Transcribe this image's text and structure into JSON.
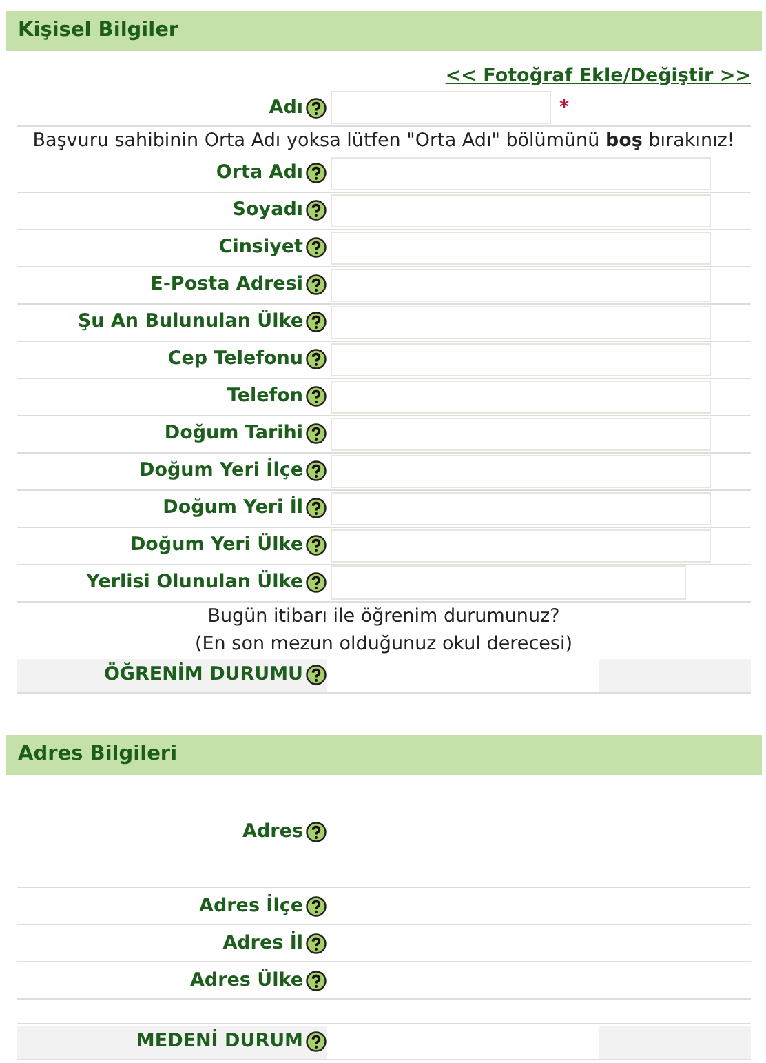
{
  "sections": [
    {
      "title": "Kişisel Bilgiler",
      "rows": [
        {
          "kind": "link",
          "text": "<< Fotoğraf Ekle/Değiştir >>"
        },
        {
          "kind": "short_field",
          "label": "Adı",
          "required_mark": "*"
        },
        {
          "kind": "note",
          "text": "Başvuru sahibinin Orta Adı yoksa lütfen \"Orta Adı\" bölümünü **boş** bırakınız!"
        },
        {
          "kind": "field",
          "label": "Orta Adı"
        },
        {
          "kind": "field",
          "label": "Soyadı"
        },
        {
          "kind": "field",
          "label": "Cinsiyet"
        },
        {
          "kind": "field",
          "label": "E-Posta Adresi"
        },
        {
          "kind": "field",
          "label": "Şu An Bulunulan Ülke"
        },
        {
          "kind": "field",
          "label": "Cep Telefonu"
        },
        {
          "kind": "field",
          "label": "Telefon"
        },
        {
          "kind": "field",
          "label": "Doğum Tarihi"
        },
        {
          "kind": "field",
          "label": "Doğum Yeri İlçe"
        },
        {
          "kind": "field",
          "label": "Doğum Yeri İl"
        },
        {
          "kind": "field",
          "label": "Doğum Yeri Ülke"
        },
        {
          "kind": "box_field",
          "label": "Yerlisi Olunulan Ülke"
        },
        {
          "kind": "note",
          "text": "Bugün itibarı ile öğrenim durumunuz?"
        },
        {
          "kind": "note",
          "text": "(En son mezun olduğunuz okul derecesi)"
        },
        {
          "kind": "gray",
          "label": "ÖĞRENİM DURUMU"
        }
      ]
    },
    {
      "title": "Adres Bilgileri",
      "rows": [
        {
          "kind": "tall_label",
          "label": "Adres"
        },
        {
          "kind": "label",
          "label": "Adres İlçe"
        },
        {
          "kind": "label",
          "label": "Adres İl"
        },
        {
          "kind": "label",
          "label": "Adres Ülke"
        },
        {
          "kind": "blank"
        },
        {
          "kind": "gray",
          "label": "MEDENİ DURUM"
        }
      ]
    }
  ]
}
